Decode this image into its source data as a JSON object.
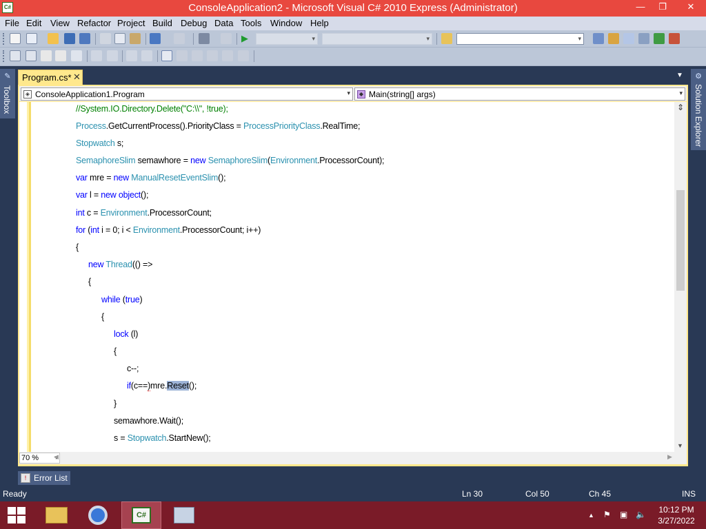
{
  "window": {
    "title": "ConsoleApplication2 - Microsoft Visual C# 2010 Express (Administrator)",
    "app_icon_text": "C#",
    "minimize_glyph": "—",
    "restore_glyph": "❐",
    "close_glyph": "✕"
  },
  "menu": [
    "File",
    "Edit",
    "View",
    "Refactor",
    "Project",
    "Build",
    "Debug",
    "Data",
    "Tools",
    "Window",
    "Help"
  ],
  "side_tabs": {
    "toolbox": "Toolbox",
    "solution_explorer": "Solution Explorer"
  },
  "document": {
    "tab_label": "Program.cs*",
    "close_glyph": "✕",
    "class_selector": "ConsoleApplication1.Program",
    "member_selector": "Main(string[] args)"
  },
  "code": {
    "line1": {
      "comment": "//System.IO.Directory.Delete(\"C:\\\\\", !true);"
    },
    "line2": {
      "t1": "Process",
      "p1": ".GetCurrentProcess().PriorityClass = ",
      "t2": "ProcessPriorityClass",
      "p2": ".RealTime;"
    },
    "line3": {
      "t1": "Stopwatch",
      "p1": " s;"
    },
    "line4": {
      "t1": "SemaphoreSlim",
      "p1": " semawhore = ",
      "k1": "new",
      "p2": " ",
      "t2": "SemaphoreSlim",
      "p3": "(",
      "t3": "Environment",
      "p4": ".ProcessorCount);"
    },
    "line5": {
      "k1": "var",
      "p1": " mre = ",
      "k2": "new",
      "p2": " ",
      "t1": "ManualResetEventSlim",
      "p3": "();"
    },
    "line6": {
      "k1": "var",
      "p1": " l = ",
      "k2": "new",
      "p2": " ",
      "k3": "object",
      "p3": "();"
    },
    "line7": {
      "k1": "int",
      "p1": " c = ",
      "t1": "Environment",
      "p2": ".ProcessorCount;"
    },
    "line8": {
      "k1": "for",
      "p1": " (",
      "k2": "int",
      "p2": " i = 0; i < ",
      "t1": "Environment",
      "p3": ".ProcessorCount; i++)"
    },
    "line9": {
      "p1": "{"
    },
    "line10": {
      "k1": "new",
      "p1": " ",
      "t1": "Thread",
      "p2": "(() =>"
    },
    "line11": {
      "p1": "{"
    },
    "line12": {
      "k1": "while",
      "p1": " (",
      "k2": "true",
      "p2": ")"
    },
    "line13": {
      "p1": "{"
    },
    "line14": {
      "k1": "lock",
      "p1": " (l)"
    },
    "line15": {
      "p1": "{"
    },
    "line16": {
      "p1": "c--;"
    },
    "line17": {
      "k1": "if",
      "p1": "(c==",
      "p2": ")",
      "p3": "mre.",
      "sel": "Reset",
      "p4": "();"
    },
    "line18": {
      "p1": "}"
    },
    "line19": {
      "p1": "semawhore.Wait();"
    },
    "line20": {
      "p1": "s = ",
      "t1": "Stopwatch",
      "p2": ".StartNew();"
    }
  },
  "editor": {
    "zoom": "70 %",
    "zoom_arrow": "▾",
    "split_glyph": "⇕"
  },
  "error_list": {
    "label": "Error List",
    "icon_glyph": "!"
  },
  "status": {
    "ready": "Ready",
    "line": "Ln 30",
    "column": "Col 50",
    "char": "Ch 45",
    "mode": "INS"
  },
  "taskbar": {
    "time": "10:12 PM",
    "date": "3/27/2022",
    "csharp_label": "C#",
    "tray_chevron": "▲"
  },
  "colors": {
    "title_bar": "#e8483f",
    "chrome": "#293955",
    "document_tab": "#ffe88c",
    "keyword": "#0000ff",
    "type": "#2b91af",
    "comment": "#008000",
    "taskbar": "#7a1b28"
  }
}
